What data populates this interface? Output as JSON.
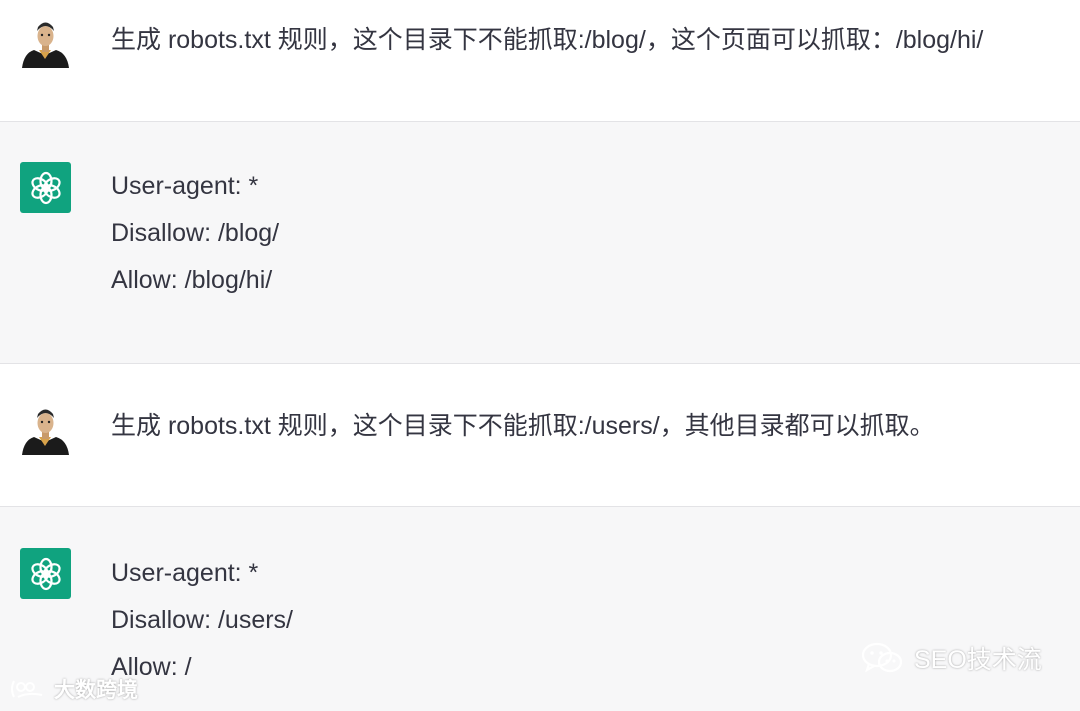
{
  "conversation": [
    {
      "role": "user",
      "avatar_icon": "user-portrait-icon",
      "text": "生成 robots.txt 规则，这个目录下不能抓取:/blog/，这个页面可以抓取：/blog/hi/"
    },
    {
      "role": "assistant",
      "avatar_icon": "openai-logo-icon",
      "lines": [
        "User-agent: *",
        "Disallow: /blog/",
        "Allow: /blog/hi/"
      ]
    },
    {
      "role": "user",
      "avatar_icon": "user-portrait-icon",
      "text": "生成 robots.txt 规则，这个目录下不能抓取:/users/，其他目录都可以抓取。"
    },
    {
      "role": "assistant",
      "avatar_icon": "openai-logo-icon",
      "lines": [
        "User-agent: *",
        "Disallow: /users/",
        "Allow: /"
      ]
    }
  ],
  "watermarks": {
    "left": "大数跨境",
    "right": "SEO技术流"
  },
  "colors": {
    "accent": "#10a37f",
    "assistant_bg": "#f7f7f8",
    "text": "#343541"
  }
}
